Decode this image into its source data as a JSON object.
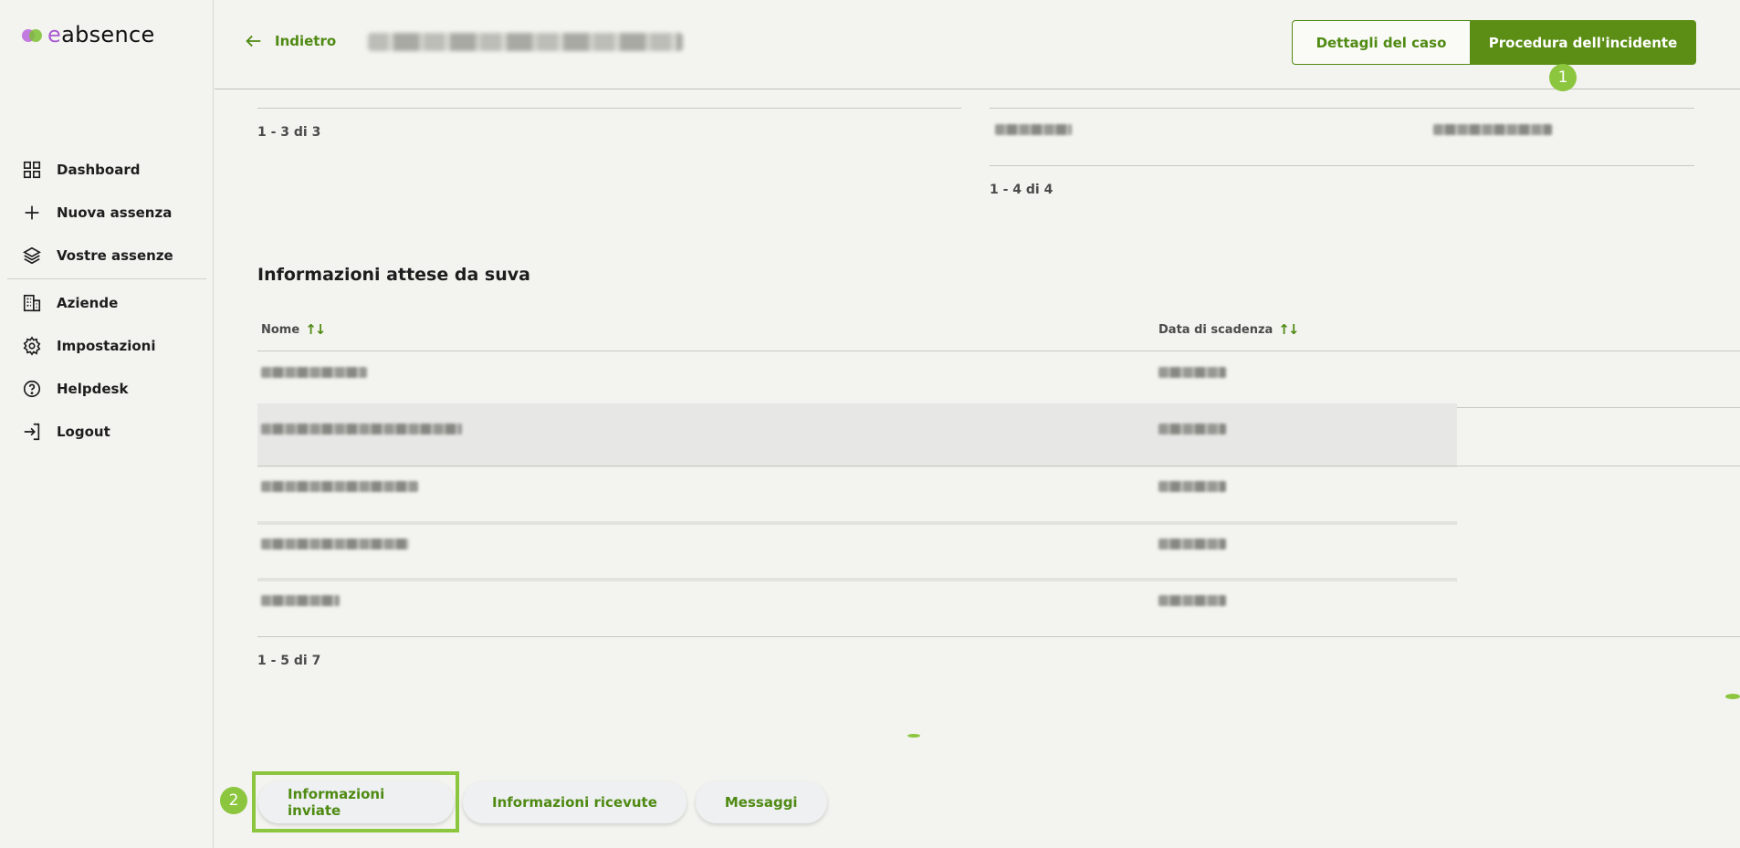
{
  "app": {
    "logo_prefix": "e",
    "logo_rest": "absence",
    "brand_color": "#4f8a12",
    "accent_color": "#8cc63f"
  },
  "sidebar": {
    "items": [
      {
        "label": "Dashboard",
        "icon": "dashboard-grid-icon"
      },
      {
        "label": "Nuova assenza",
        "icon": "plus-icon"
      },
      {
        "label": "Vostre assenze",
        "icon": "layers-icon"
      },
      {
        "label": "Aziende",
        "icon": "building-icon"
      },
      {
        "label": "Impostazioni",
        "icon": "gear-icon"
      },
      {
        "label": "Helpdesk",
        "icon": "help-circle-icon"
      },
      {
        "label": "Logout",
        "icon": "logout-icon"
      }
    ]
  },
  "header": {
    "back_label": "Indietro",
    "details_button": "Dettagli del caso",
    "procedure_button": "Procedura dell'incidente",
    "annotation_1": "1"
  },
  "upper_tables": {
    "left_pager": "1 - 3 di 3",
    "right_pager": "1 - 4 di 4"
  },
  "expected_info": {
    "title": "Informazioni attese da suva",
    "col_name": "Nome",
    "col_due": "Data di scadenza",
    "sort_icon": "sort-arrows-icon",
    "pager": "1 - 5 di 7"
  },
  "bottom_tabs": {
    "sent": "Informazioni inviate",
    "received": "Informazioni ricevute",
    "messages": "Messaggi",
    "annotation_2": "2"
  }
}
